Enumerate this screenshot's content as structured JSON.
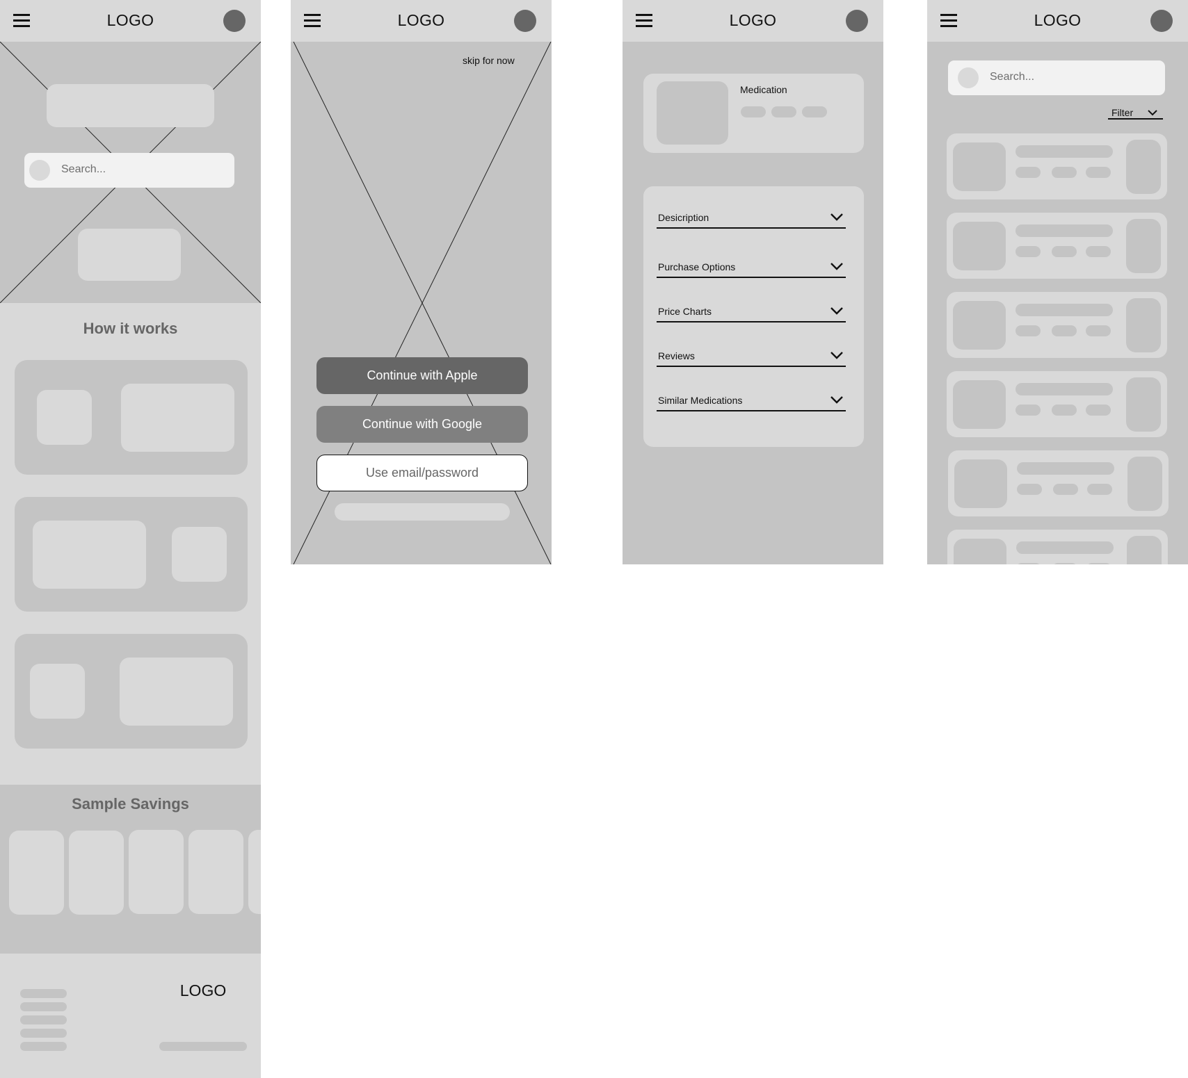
{
  "screens": {
    "home": {
      "header": {
        "logo": "LOGO",
        "menu_icon": "hamburger-icon",
        "avatar_icon": "avatar"
      },
      "hero": {
        "search_placeholder": "Search..."
      },
      "how_it_works": {
        "title": "How it works"
      },
      "sample_savings": {
        "title": "Sample Savings"
      },
      "footer": {
        "logo": "LOGO"
      }
    },
    "signin": {
      "header": {
        "logo": "LOGO"
      },
      "skip_link": "skip for now",
      "buttons": {
        "apple": "Continue with Apple",
        "google": "Continue with Google",
        "email": "Use email/password"
      }
    },
    "medication": {
      "header": {
        "logo": "LOGO"
      },
      "card": {
        "title": "Medication"
      },
      "accordion": [
        {
          "label": "Desicription",
          "icon": "chevron-down-icon"
        },
        {
          "label": "Purchase Options",
          "icon": "chevron-down-icon"
        },
        {
          "label": "Price Charts",
          "icon": "chevron-down-icon"
        },
        {
          "label": "Reviews",
          "icon": "chevron-down-icon"
        },
        {
          "label": "Similar Medications",
          "icon": "chevron-down-icon"
        }
      ]
    },
    "search": {
      "header": {
        "logo": "LOGO"
      },
      "search_placeholder": "Search...",
      "filter_label": "Filter"
    }
  },
  "colors": {
    "header_bg": "#d9d9d9",
    "panel_bg": "#c4c4c4",
    "avatar": "#666666",
    "apple_button": "#666666",
    "google_button": "#808080",
    "search_bg": "#f2f2f2"
  }
}
